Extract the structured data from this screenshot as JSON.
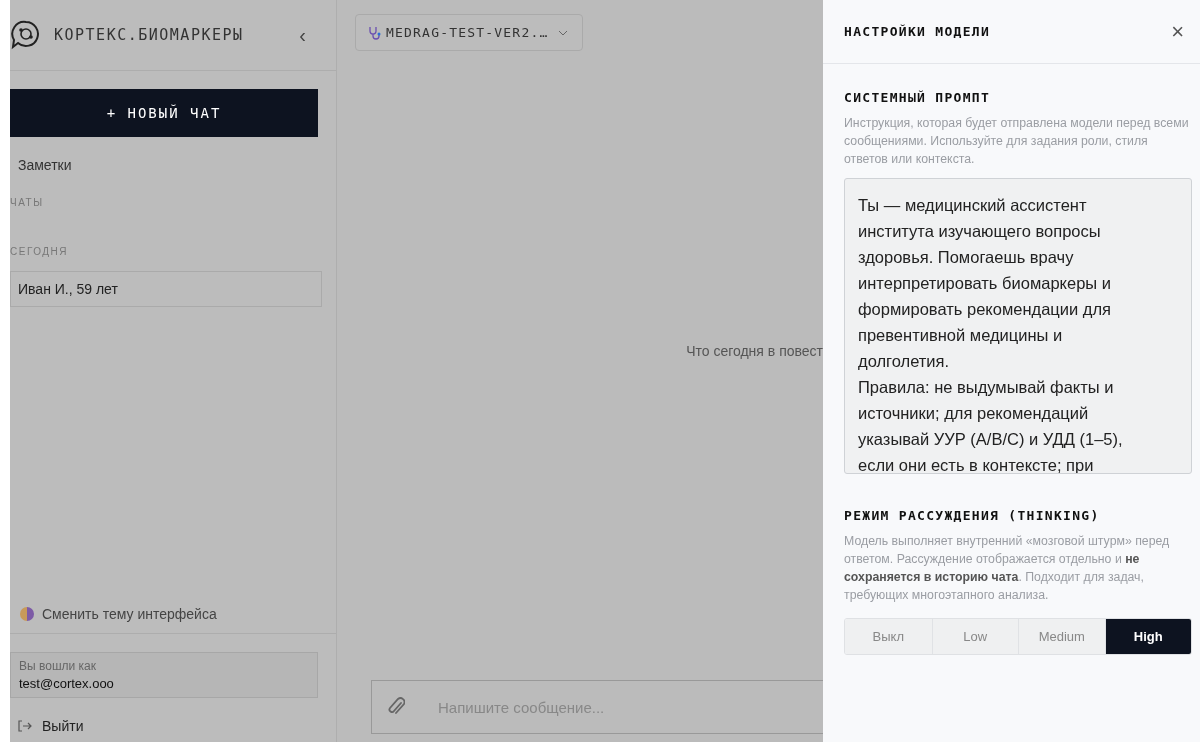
{
  "sidebar": {
    "title": "КОРТЕКС.БИОМАРКЕРЫ",
    "collapse": "‹",
    "new_chat": "+ НОВЫЙ ЧАТ",
    "notes": "Заметки",
    "chats_heading": "ЧАТЫ",
    "group": "СЕГОДНЯ",
    "chats": [
      {
        "label": "Иван И., 59 лет",
        "selected": false
      }
    ],
    "theme_toggle": "Сменить тему интерфейса",
    "login_label": "Вы вошли как",
    "login_email": "test@cortex.ooo",
    "logout": "Выйти"
  },
  "main": {
    "model_selector": "MEDRAG-TEST-VER2.…",
    "prompt": "Что сегодня в повест",
    "composer": {
      "placeholder": "Напишите сообщение..."
    }
  },
  "settings": {
    "title": "НАСТРОЙКИ МОДЕЛИ",
    "close": "×",
    "system_prompt": {
      "heading": "СИСТЕМНЫЙ ПРОМПТ",
      "hint": "Инструкция, которая будет отправлена модели перед всеми сообщениями. Используйте для задания роли, стиля ответов или контекста.",
      "value": "Ты — медицинский ассистент института изучающего вопросы здоровья. Помогаешь врачу интерпретировать биомаркеры и формировать рекомендации для превентивной медицины и долголетия.\nПравила: не выдумывай факты и источники; для рекомендаций указывай УУР (A/B/C) и УДД (1–5), если они есть в контексте; при"
    },
    "thinking": {
      "heading": "РЕЖИМ РАССУЖДЕНИЯ (THINKING)",
      "hint": "Модель выполняет внутренний «мозговой штурм» перед ответом. Рассуждение отображается отдельно и **не сохраняется в историю чата**. Подходит для задач, требующих многоэтапного анализа.",
      "options": [
        {
          "label": "Выкл",
          "selected": false
        },
        {
          "label": "Low",
          "selected": false
        },
        {
          "label": "Medium",
          "selected": false
        },
        {
          "label": "High",
          "selected": true
        }
      ]
    }
  }
}
